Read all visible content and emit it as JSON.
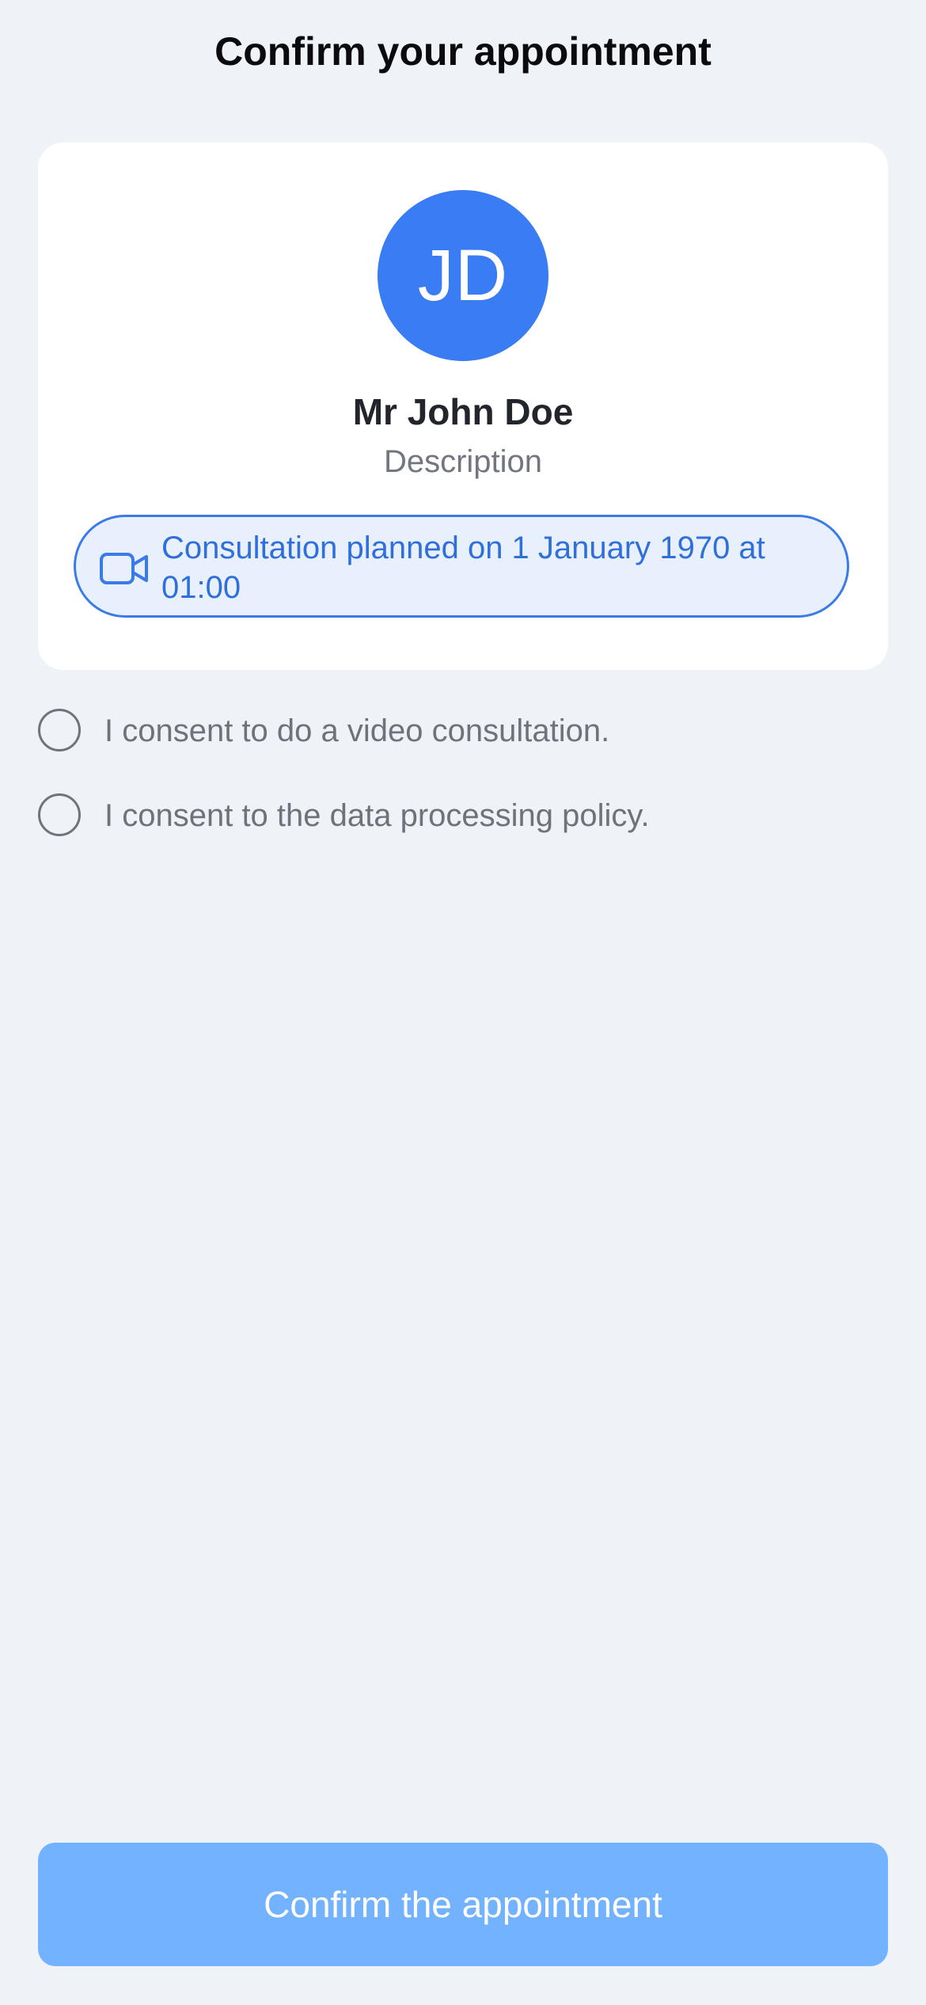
{
  "header": {
    "title": "Confirm your appointment"
  },
  "doctor": {
    "initials": "JD",
    "name": "Mr John Doe",
    "description": "Description",
    "avatar_color": "#3a7cf4"
  },
  "consultation": {
    "icon": "video-camera-icon",
    "text": "Consultation planned on 1 January 1970 at 01:00"
  },
  "consents": [
    {
      "label": "I consent to do a video consultation.",
      "checked": false
    },
    {
      "label": "I consent to the data processing policy.",
      "checked": false
    }
  ],
  "footer": {
    "confirm_label": "Confirm the appointment",
    "confirm_color": "#72b2ff"
  },
  "colors": {
    "background": "#eff3f8",
    "accent": "#3a7be8"
  }
}
